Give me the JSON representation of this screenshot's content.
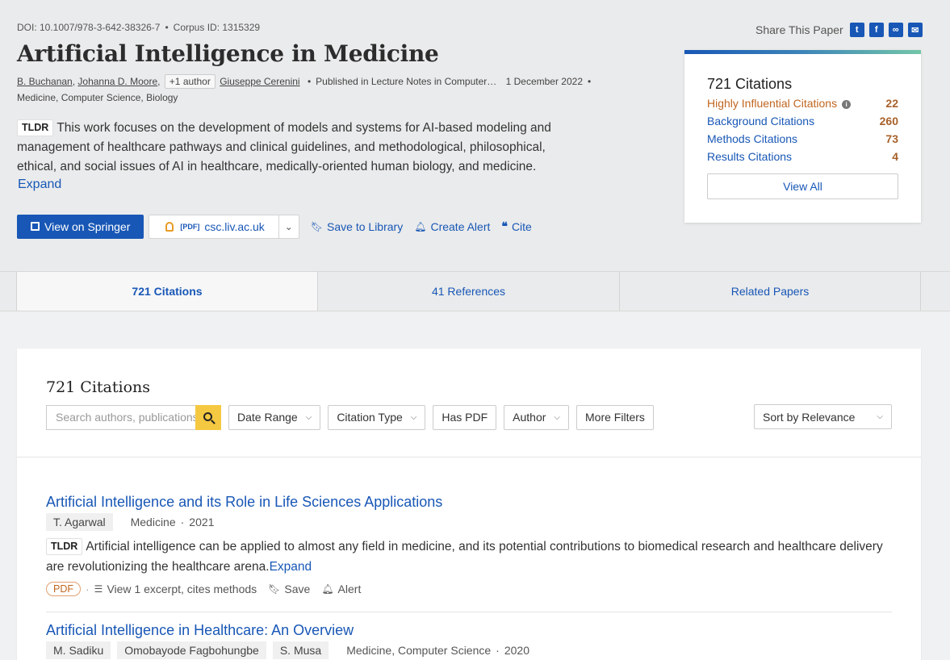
{
  "paper": {
    "doi": "DOI: 10.1007/978-3-642-38326-7",
    "corpus": "Corpus ID: 1315329",
    "title": "Artificial Intelligence in Medicine",
    "authors": [
      "B. Buchanan",
      "Johanna D. Moore"
    ],
    "more_authors": "+1 author",
    "last_author": "Giuseppe Cerenini",
    "venue": "Published in Lecture Notes in Computer…",
    "date": "1 December 2022",
    "fields": "Medicine, Computer Science, Biology",
    "tldr_tag": "TLDR",
    "tldr": "This work focuses on the development of models and systems for AI-based modeling and management of healthcare pathways and clinical guidelines, and methodological, philosophical, ethical, and social issues of AI in healthcare, medically-oriented human biology, and medicine.",
    "expand": "Expand"
  },
  "actions": {
    "view": "View on Springer",
    "pdf_label": "[PDF]",
    "pdf_source": "csc.liv.ac.uk",
    "save": "Save to Library",
    "alert": "Create Alert",
    "cite": "Cite"
  },
  "share": {
    "label": "Share This Paper",
    "icons": [
      "twitter-icon",
      "facebook-icon",
      "link-icon",
      "email-icon"
    ]
  },
  "citations_card": {
    "title": "721 Citations",
    "rows": [
      {
        "label": "Highly Influential Citations",
        "value": "22"
      },
      {
        "label": "Background Citations",
        "value": "260"
      },
      {
        "label": "Methods Citations",
        "value": "73"
      },
      {
        "label": "Results Citations",
        "value": "4"
      }
    ],
    "view_all": "View All"
  },
  "tabs": [
    "721 Citations",
    "41 References",
    "Related Papers"
  ],
  "list": {
    "heading": "721 Citations",
    "search_placeholder": "Search authors, publications",
    "filters": {
      "date": "Date Range",
      "type": "Citation Type",
      "pdf": "Has PDF",
      "author": "Author",
      "more": "More Filters"
    },
    "sort": "Sort by Relevance"
  },
  "results": [
    {
      "title": "Artificial Intelligence and its Role in Life Sciences Applications",
      "authors": [
        "T. Agarwal"
      ],
      "venue": "Medicine",
      "year": "2021",
      "tldr": "Artificial intelligence can be applied to almost any field in medicine, and its potential contributions to biomedical research and healthcare delivery are revolutionizing the healthcare arena.",
      "expand": "Expand",
      "pdf": "PDF",
      "excerpt": "View 1 excerpt, cites methods",
      "save": "Save",
      "alert": "Alert"
    },
    {
      "title": "Artificial Intelligence in Healthcare: An Overview",
      "authors": [
        "M. Sadiku",
        "Omobayode Fagbohungbe",
        "S. Musa"
      ],
      "venue": "Medicine, Computer Science",
      "year": "2020"
    }
  ],
  "colors": {
    "brand_blue": "#1857b6",
    "accent_orange": "#c0661f",
    "search_yellow": "#f5c842"
  }
}
